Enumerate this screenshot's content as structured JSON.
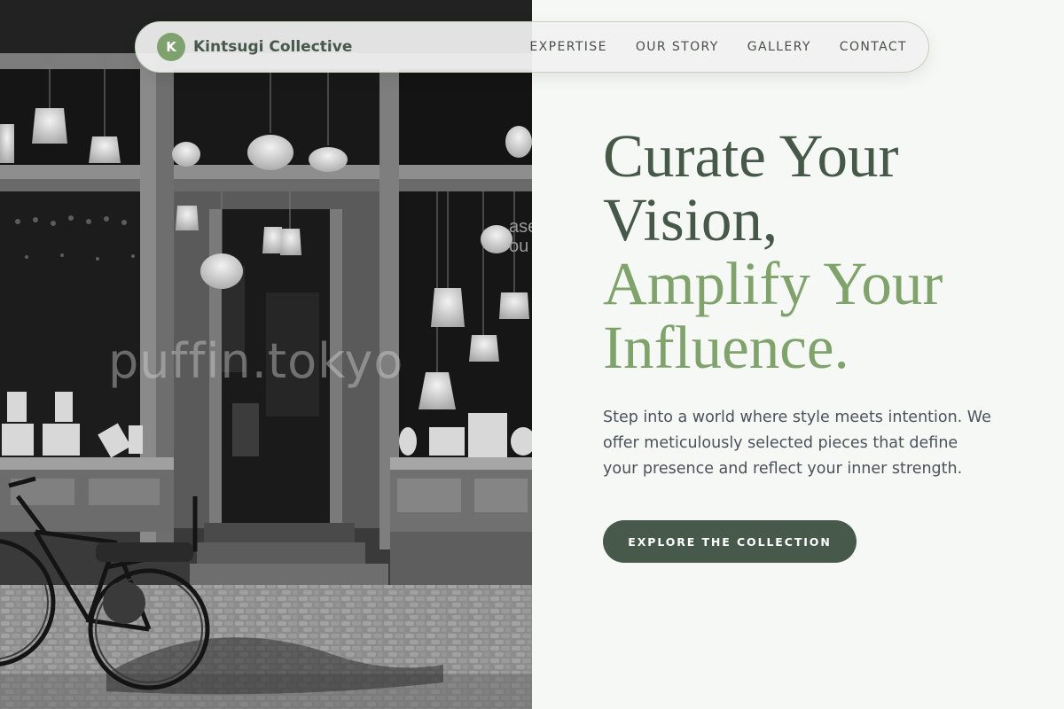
{
  "brand": {
    "initial": "K",
    "name": "Kintsugi Collective"
  },
  "nav": {
    "links": [
      {
        "label": "EXPERTISE"
      },
      {
        "label": "OUR STORY"
      },
      {
        "label": "GALLERY"
      },
      {
        "label": "CONTACT"
      }
    ]
  },
  "photo": {
    "watermark": "puffin.tokyo",
    "shop_sign": "ase\nou"
  },
  "hero": {
    "headline_line1": "Curate Your",
    "headline_line2": "Vision,",
    "headline_line3": "Amplify Your",
    "headline_line4": "Influence.",
    "description": "Step into a world where style meets intention. We offer meticulously selected pieces that define your presence and reflect your inner strength.",
    "cta_label": "EXPLORE THE COLLECTION"
  },
  "colors": {
    "page_background": "#f6f8f5",
    "primary_dark": "#47594a",
    "accent_green": "#80a36c",
    "body_text": "#4a525a"
  }
}
